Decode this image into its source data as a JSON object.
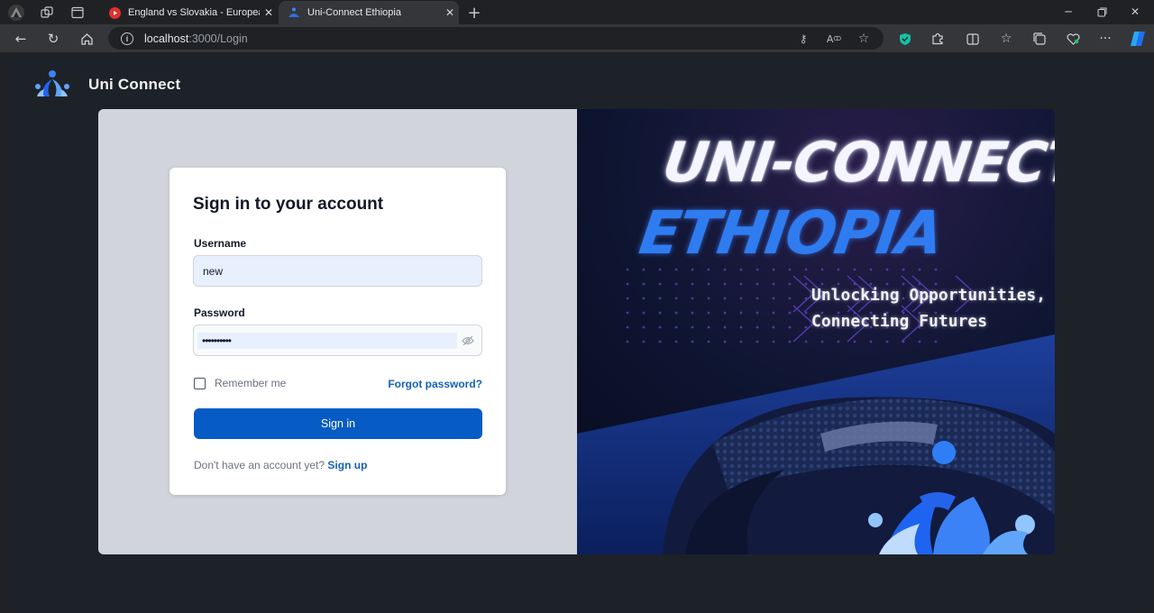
{
  "browser": {
    "tabs": [
      {
        "title": "England vs Slovakia - European C",
        "favicon": "youtube-icon"
      },
      {
        "title": "Uni-Connect Ethiopia",
        "favicon": "uniconnect-icon"
      }
    ],
    "url_host": "localhost",
    "url_path": ":3000/Login"
  },
  "brand": {
    "name": "Uni Connect"
  },
  "form": {
    "title": "Sign in to your account",
    "username_label": "Username",
    "username_value": "new",
    "password_label": "Password",
    "password_value": "••••••••••",
    "remember_label": "Remember me",
    "forgot_label": "Forgot password?",
    "submit_label": "Sign in",
    "signup_prompt": "Don't have an account yet?",
    "signup_link": "Sign up"
  },
  "banner": {
    "line1": "UNI-CONNECT",
    "line2": "ETHIOPIA",
    "tagline1": "Unlocking Opportunities,",
    "tagline2": "Connecting Futures"
  },
  "colors": {
    "primary": "#075bc4",
    "link": "#1661b7",
    "page_bg": "#1d2229"
  }
}
